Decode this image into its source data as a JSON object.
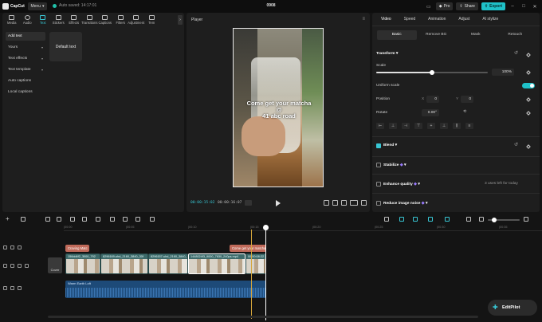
{
  "titlebar": {
    "app_name": "CapCut",
    "menu_label": "Menu",
    "autosave": "Auto saved: 14:17:01",
    "project_title": "0908",
    "pro_label": "Pro",
    "share_label": "Share",
    "export_label": "Export"
  },
  "tools": [
    {
      "label": "Media"
    },
    {
      "label": "Audio"
    },
    {
      "label": "Text"
    },
    {
      "label": "Stickers"
    },
    {
      "label": "Effects"
    },
    {
      "label": "Transitions"
    },
    {
      "label": "Captions"
    },
    {
      "label": "Filters"
    },
    {
      "label": "Adjustment"
    },
    {
      "label": "Tem"
    }
  ],
  "text_menu": {
    "items": [
      {
        "label": "Add text"
      },
      {
        "label": "Yours"
      },
      {
        "label": "Text effects"
      },
      {
        "label": "Text template"
      },
      {
        "label": "Auto captions"
      },
      {
        "label": "Local captions"
      }
    ],
    "default_card": "Default text"
  },
  "player": {
    "title": "Player",
    "overlay_line1": "Come get your matcha",
    "overlay_line2": "@",
    "overlay_line3": "41 abc road",
    "current_time": "00:00:15:02",
    "duration": "00:00:16:07"
  },
  "inspector": {
    "tabs": [
      {
        "label": "Video"
      },
      {
        "label": "Speed"
      },
      {
        "label": "Animation"
      },
      {
        "label": "Adjust"
      },
      {
        "label": "AI stylize"
      }
    ],
    "subtabs": [
      {
        "label": "Basic"
      },
      {
        "label": "Remove BG"
      },
      {
        "label": "Mask"
      },
      {
        "label": "Retouch"
      }
    ],
    "transform_label": "Transform",
    "scale_label": "Scale",
    "scale_value": "100%",
    "scale_fraction": 0.5,
    "uniform_scale_label": "Uniform scale",
    "position_label": "Position",
    "pos_x_label": "X",
    "pos_x": "0",
    "pos_y_label": "Y",
    "pos_y": "0",
    "rotate_label": "Rotate",
    "rotate_value": "0.00°",
    "blend_label": "Blend",
    "stabilize_label": "Stabilize",
    "enhance_label": "Enhance quality",
    "enhance_note": "3 uses left for today",
    "noise_label": "Reduce image noise"
  },
  "timeline": {
    "ruler_ticks": [
      "|00:00",
      "|00:05",
      "|00:10",
      "|00:15",
      "|00:20",
      "|00:25",
      "|00:30",
      "|00:35"
    ],
    "text_clip_1": "Craving Matc",
    "text_clip_2": "Come get your matcha",
    "video_clips": [
      {
        "label": "156dd4f2_3000_792"
      },
      {
        "label": "8296169-uhd_2160_3840_30f"
      },
      {
        "label": "8296157-uhd_2160_3840_"
      },
      {
        "label": "8296115-uhd_21"
      },
      {
        "label": "1448024f3_9000_7630_240ps.mp4"
      },
      {
        "label": "00:00:08:22"
      }
    ],
    "audio_clip": "Warm Earth Loft",
    "cover_label": "Cover"
  },
  "editpilot_label": "EditPilot",
  "colors": {
    "accent": "#1fc1c8",
    "text_clip": "#c06a5a",
    "video_clip": "#3d6a6a",
    "audio_clip": "#1d4a78"
  }
}
